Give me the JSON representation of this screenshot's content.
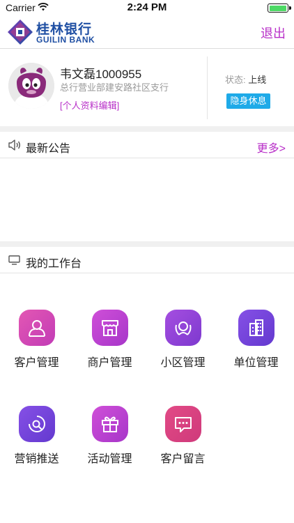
{
  "status_bar": {
    "carrier": "Carrier",
    "time": "2:24 PM",
    "battery_level": 1.0
  },
  "nav": {
    "bank_name_cn": "桂林银行",
    "bank_name_en": "GUILIN BANK",
    "logout_label": "退出"
  },
  "profile": {
    "name": "韦文磊1000955",
    "branch": "总行营业部建安路社区支行",
    "edit_label": "[个人资料编辑]",
    "status_label": "状态:",
    "status_value": "上线",
    "status_button": "隐身休息"
  },
  "announcements": {
    "title": "最新公告",
    "more_label": "更多>"
  },
  "workbench": {
    "title": "我的工作台",
    "items": [
      {
        "label": "客户管理",
        "icon": "person-icon",
        "color": "#d549b5"
      },
      {
        "label": "商户管理",
        "icon": "store-icon",
        "color": "#c043d0"
      },
      {
        "label": "小区管理",
        "icon": "community-icon",
        "color": "#9545d8"
      },
      {
        "label": "单位管理",
        "icon": "building-icon",
        "color": "#7444d9"
      },
      {
        "label": "营销推送",
        "icon": "push-icon",
        "color": "#7444d9"
      },
      {
        "label": "活动管理",
        "icon": "gift-icon",
        "color": "#c043d0"
      },
      {
        "label": "客户留言",
        "icon": "message-icon",
        "color": "#d8427f"
      }
    ]
  }
}
